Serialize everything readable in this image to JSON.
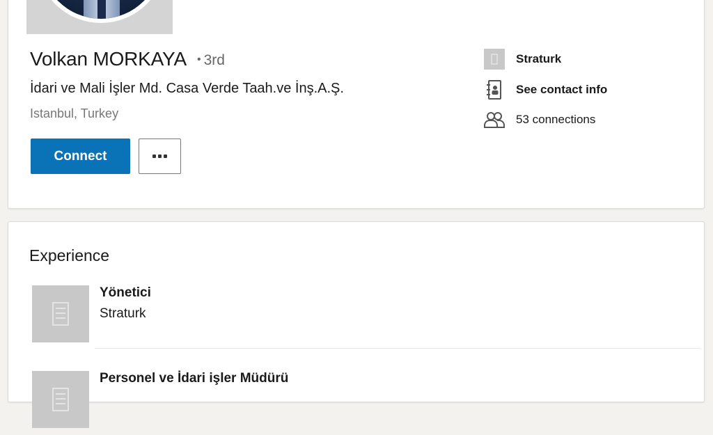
{
  "profile": {
    "name": "Volkan MORKAYA",
    "degree": "3rd",
    "headline": "İdari ve Mali İşler Md. Casa Verde Taah.ve İnş.A.Ş.",
    "location": "Istanbul, Turkey",
    "connect_label": "Connect",
    "more_icon": "ellipsis-icon"
  },
  "info": {
    "company": "Straturk",
    "contact": "See contact info",
    "connections": "53 connections"
  },
  "experience": {
    "title": "Experience",
    "items": [
      {
        "title": "Yönetici",
        "company": "Straturk"
      },
      {
        "title": "Personel ve İdari işler Müdürü",
        "company": ""
      }
    ]
  },
  "colors": {
    "primary": "#0a73b7",
    "placeholder": "#c8c8c8"
  }
}
